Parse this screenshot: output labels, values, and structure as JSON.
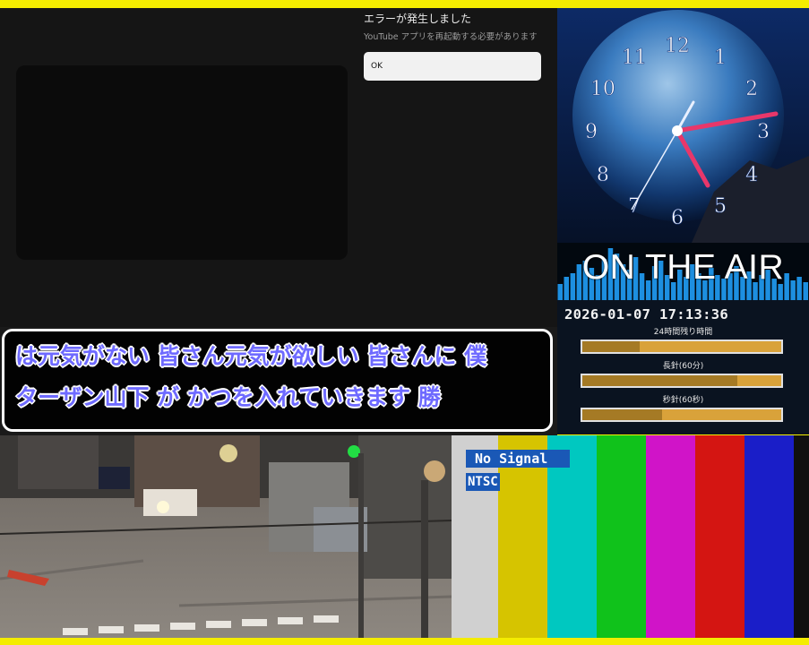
{
  "youtube_error": {
    "title": "エラーが発生しました",
    "message": "YouTube アプリを再起動する必要があります",
    "ok_label": "OK"
  },
  "clock": {
    "numerals": [
      "12",
      "1",
      "2",
      "3",
      "4",
      "5",
      "6",
      "7",
      "8",
      "9",
      "10",
      "11"
    ],
    "hands_color": "#e8376a"
  },
  "on_air": {
    "label": "ON THE AIR",
    "equalizer_color": "#1d8fe0"
  },
  "time_panel": {
    "datetime": "2026-01-07  17:13:36",
    "day_caption": "24時間残り時間",
    "minute_caption": "長針(60分)",
    "second_caption": "秒針(60秒)",
    "day_remaining_fraction": 0.29,
    "minute_remaining_fraction": 0.78,
    "second_remaining_fraction": 0.4
  },
  "subtitle": {
    "line1": "は元気がない 皆さん元気が欲しい 皆さんに 僕",
    "line2": "ターザン山下 が かつを入れていきます 勝"
  },
  "test_pattern": {
    "no_signal": "No Signal",
    "format": "NTSC",
    "colors": [
      "#d0d0d0",
      "#d6c400",
      "#00c8c0",
      "#10c21b",
      "#d014c8",
      "#d41512",
      "#1a1ec8",
      "#101010"
    ]
  }
}
